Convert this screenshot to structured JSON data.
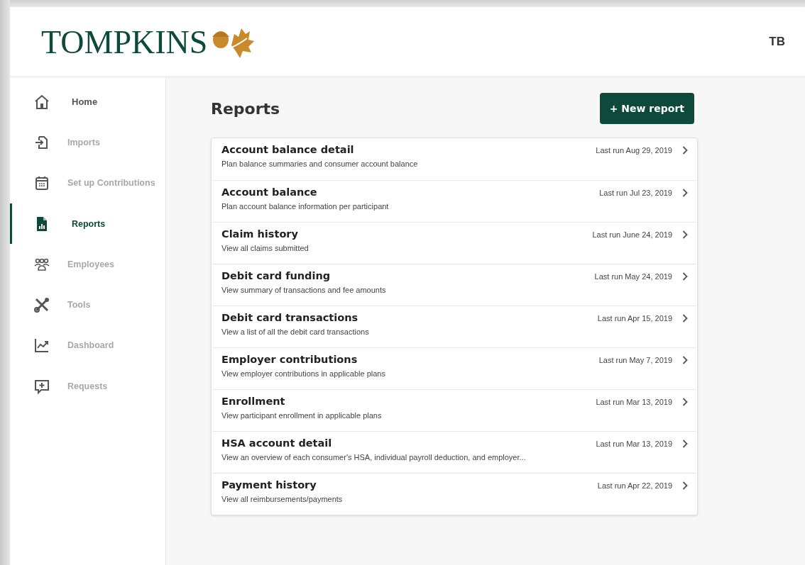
{
  "header": {
    "logo": "TOMPKINS",
    "user_initials": "TB"
  },
  "sidebar": {
    "items": [
      {
        "label": "Home",
        "selected": false,
        "hovered": true
      },
      {
        "label": "Imports",
        "selected": false,
        "hovered": false
      },
      {
        "label": "Set up Contributions",
        "selected": false,
        "hovered": false
      },
      {
        "label": "Reports",
        "selected": true,
        "hovered": false
      },
      {
        "label": "Employees",
        "selected": false,
        "hovered": false
      },
      {
        "label": "Tools",
        "selected": false,
        "hovered": false
      },
      {
        "label": "Dashboard",
        "selected": false,
        "hovered": false
      },
      {
        "label": "Requests",
        "selected": false,
        "hovered": false
      }
    ]
  },
  "page": {
    "title": "Reports",
    "new_button": "+ New report"
  },
  "reports": [
    {
      "name": "Account balance detail",
      "description": "Plan balance summaries and consumer account balance",
      "last_run": "Last run Aug 29, 2019"
    },
    {
      "name": "Account balance",
      "description": "Plan account balance information per participant",
      "last_run": "Last run Jul 23, 2019"
    },
    {
      "name": "Claim history",
      "description": "View all claims submitted",
      "last_run": "Last run June 24, 2019"
    },
    {
      "name": "Debit card funding",
      "description": "View summary of transactions and fee amounts",
      "last_run": "Last run May 24, 2019"
    },
    {
      "name": "Debit card transactions",
      "description": "View a list of all the debit card transactions",
      "last_run": "Last run Apr 15, 2019"
    },
    {
      "name": "Employer contributions",
      "description": "View employer contributions in applicable plans",
      "last_run": "Last run May 7, 2019"
    },
    {
      "name": "Enrollment",
      "description": "View participant enrollment in applicable plans",
      "last_run": "Last run Mar 13, 2019"
    },
    {
      "name": "HSA account detail",
      "description": "View an overview of each consumer's HSA, individual payroll deduction, and employer...",
      "last_run": "Last run Mar 13, 2019"
    },
    {
      "name": "Payment history",
      "description": "View all reimbursements/payments",
      "last_run": "Last run Apr 22, 2019"
    }
  ]
}
